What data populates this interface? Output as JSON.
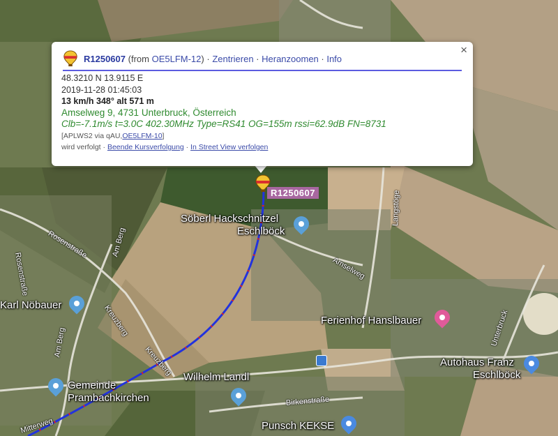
{
  "popup": {
    "balloon_icon": "hot-air-balloon-icon",
    "id": "R1250607",
    "from_prefix": "(from",
    "from_call": "OE5LFM-12",
    "from_suffix": ")",
    "link_center": "Zentrieren",
    "link_zoom": "Heranzoomen",
    "link_info": "Info",
    "sep": " · ",
    "coords": "48.3210 N 13.9115 E",
    "datetime": "2019-11-28 01:45:03",
    "motion": "13 km/h 348° alt 571 m",
    "address": "Amselweg 9, 4731 Unterbruck, Österreich",
    "telemetry": "Clb=-7.1m/s t=3.0C 402.30MHz Type=RS41 OG=155m rssi=62.9dB FN=8731",
    "path_prefix": "[APLWS2 via qAU,",
    "path_call": "OE5LFM-10",
    "path_suffix": "]",
    "tracked": "wird verfolgt",
    "stop_tracking": "Beende Kursverfolgung",
    "streetview": "In Street View verfolgen",
    "close": "×"
  },
  "map": {
    "marker_label": "R1250607",
    "places": {
      "soeberl_1": "Söberl Hackschnitzel",
      "soeberl_2": "Eschlböck",
      "karl": "Karl Nöbauer",
      "ferienhof": "Ferienhof Hanslbauer",
      "gemeinde_1": "Gemeinde",
      "gemeinde_2": "Prambachkirchen",
      "wilhelm": "Wilhelm Landl",
      "autohaus_1": "Autohaus Franz",
      "autohaus_2": "Eschlböck",
      "punsch": "Punsch KEKSE"
    },
    "streets": {
      "rosenstrasse_a": "Rosenstraße",
      "rosenstrasse_b": "Rosenstraße",
      "am_berg_a": "Am Berg",
      "am_berg_b": "Am Berg",
      "kreuzberg_a": "Kreuzberg",
      "kreuzberg_b": "Kreuzberg",
      "amselweg": "Amselweg",
      "langstoegen": "Langstöge",
      "unterbruck": "Unterbruck",
      "birkenstrasse": "Birkenstraße",
      "mitterweg": "Mitterweg"
    },
    "colors": {
      "track": "#2233dd",
      "track_dots": "#dd2222",
      "pin_blue": "#5aa0d8",
      "pin_pink": "#e05a9a",
      "pin_shop": "#4a8ae0"
    }
  }
}
